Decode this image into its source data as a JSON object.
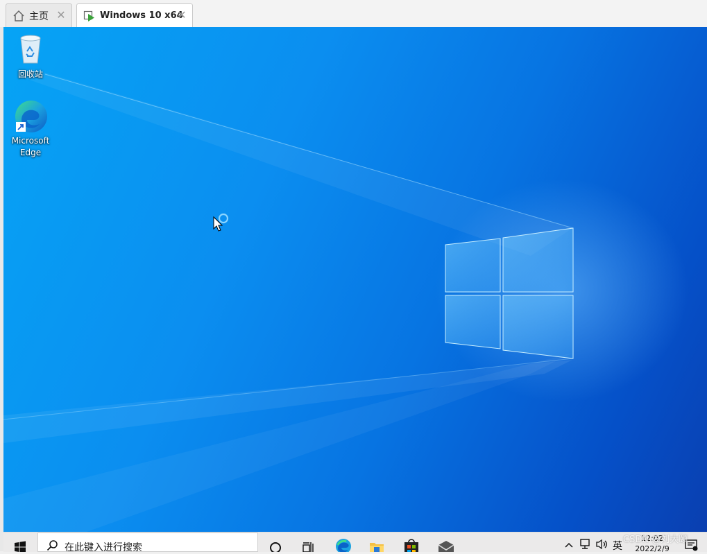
{
  "tabs": [
    {
      "label": "主页",
      "icon": "home-icon"
    },
    {
      "label": "Windows 10 x64",
      "icon": "vm-icon"
    }
  ],
  "desktop": {
    "icons": [
      {
        "label": "回收站",
        "icon": "recycle-bin-icon"
      },
      {
        "label": "Microsoft Edge",
        "icon": "edge-icon"
      }
    ]
  },
  "taskbar": {
    "search_placeholder": "在此键入进行搜索",
    "pinned": [
      "start-icon",
      "cortana-icon",
      "task-view-icon",
      "edge-icon",
      "file-explorer-icon",
      "store-icon",
      "mail-icon"
    ],
    "tray": {
      "language": "英",
      "time": "12:02",
      "date": "2022/2/9"
    }
  },
  "watermark": "CSDN @刘大颐",
  "colors": {
    "desktop_light": "#06a4f5",
    "desktop_dark": "#0a3fb0",
    "taskbar": "#ebeaea",
    "vm_play_green": "#3aa23a"
  }
}
